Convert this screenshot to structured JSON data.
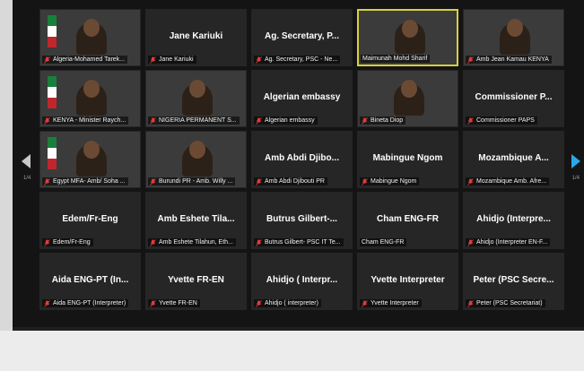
{
  "accent": {
    "active_speaker_border": "#d8d23a",
    "next_arrow": "#2aa7e8"
  },
  "pagination": {
    "left": "1/4",
    "right": "1/4"
  },
  "tiles": [
    {
      "name": "",
      "label": "Algeria-Mohamed Tarek...",
      "video": true,
      "scene": "office",
      "muted": true
    },
    {
      "name": "Jane Kariuki",
      "label": "Jane Kariuki",
      "video": false,
      "muted": true
    },
    {
      "name": "Ag. Secretary, P...",
      "label": "Ag. Secretary, PSC - Ne...",
      "video": false,
      "muted": true
    },
    {
      "name": "",
      "label": "Maimunah Mohd Sharif",
      "video": true,
      "scene": "blue",
      "active": true,
      "muted": false
    },
    {
      "name": "",
      "label": "Amb Jean Kamau KENYA",
      "video": true,
      "scene": "light",
      "muted": true
    },
    {
      "name": "",
      "label": "KENYA - Minister Raych...",
      "video": true,
      "scene": "flag",
      "muted": true
    },
    {
      "name": "",
      "label": "NIGERIA PERMANENT S...",
      "video": true,
      "scene": "room",
      "muted": true
    },
    {
      "name": "Algerian embassy",
      "label": "Algerian embassy",
      "video": false,
      "muted": true
    },
    {
      "name": "",
      "label": "Bineta Diop",
      "video": true,
      "scene": "room",
      "muted": true
    },
    {
      "name": "Commissioner P...",
      "label": "Commissioner PAPS",
      "video": false,
      "muted": true
    },
    {
      "name": "",
      "label": "Egypt MFA- Amb/ Soha ...",
      "video": true,
      "scene": "flag",
      "muted": true
    },
    {
      "name": "",
      "label": "Burundi PR - Amb. Willy ...",
      "video": true,
      "scene": "white",
      "muted": true
    },
    {
      "name": "Amb Abdi Djibo...",
      "label": "Amb Abdi Djibouti PR",
      "video": false,
      "muted": true
    },
    {
      "name": "Mabingue Ngom",
      "label": "Mabingue Ngom",
      "video": false,
      "muted": true
    },
    {
      "name": "Mozambique A...",
      "label": "Mozambique Amb. Afre...",
      "video": false,
      "muted": true
    },
    {
      "name": "Edem/Fr-Eng",
      "label": "Edem/Fr-Eng",
      "video": false,
      "muted": true
    },
    {
      "name": "Amb Eshete Tila...",
      "label": "Amb Eshete Tilahun, Eth...",
      "video": false,
      "muted": true
    },
    {
      "name": "Butrus Gilbert-...",
      "label": "Butrus Gilbert- PSC IT Te...",
      "video": false,
      "muted": true
    },
    {
      "name": "Cham ENG-FR",
      "label": "Cham ENG-FR",
      "video": false,
      "muted": false
    },
    {
      "name": "Ahidjo (Interpre...",
      "label": "Ahidjo (Interpreter EN-F...",
      "video": false,
      "muted": true
    },
    {
      "name": "Aida ENG-PT (In...",
      "label": "Aida ENG-PT (Interpreter)",
      "video": false,
      "muted": true
    },
    {
      "name": "Yvette FR-EN",
      "label": "Yvette FR-EN",
      "video": false,
      "muted": true
    },
    {
      "name": "Ahidjo ( Interpr...",
      "label": "Ahidjo ( interpreter)",
      "video": false,
      "muted": true
    },
    {
      "name": "Yvette Interpreter",
      "label": "Yvette Interpreter",
      "video": false,
      "muted": true
    },
    {
      "name": "Peter (PSC Secre...",
      "label": "Peter (PSC Secretariat)",
      "video": false,
      "muted": true
    }
  ]
}
